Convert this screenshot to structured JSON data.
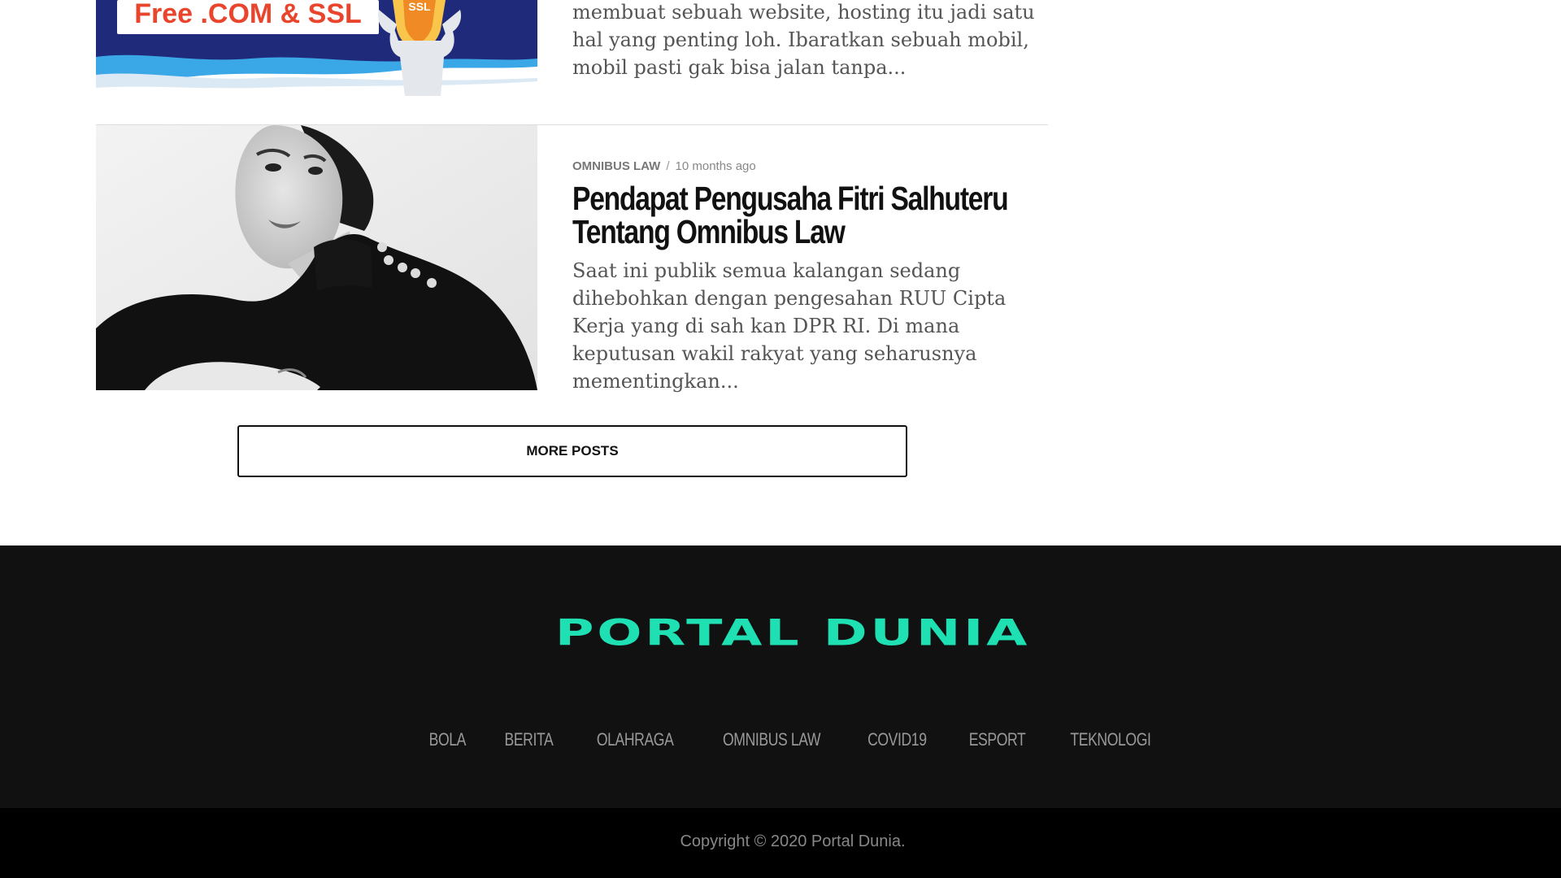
{
  "posts": [
    {
      "image_text": "Free .COM & SSL",
      "badge_text": "SSL",
      "excerpt": "membuat sebuah website, hosting itu jadi satu hal yang penting loh. Ibaratkan sebuah mobil, mobil pasti gak bisa jalan tanpa..."
    },
    {
      "category": "OMNIBUS LAW",
      "separator": "/",
      "time": "10 months ago",
      "title": "Pendapat Pengusaha Fitri Salhuteru Tentang Omnibus Law",
      "excerpt": "Saat ini publik semua kalangan sedang dihebohkan dengan pengesahan RUU Cipta Kerja yang di sah kan DPR RI. Di mana keputusan wakil rakyat yang seharusnya mementingkan..."
    }
  ],
  "more_posts_label": "MORE POSTS",
  "footer": {
    "logo": "PORTAL DUNIA",
    "logo_color": "#1ee0b2",
    "nav": [
      "BOLA",
      "BERITA",
      "OLAHRAGA",
      "OMNIBUS LAW",
      "COVID19",
      "ESPORT",
      "TEKNOLOGI"
    ],
    "copyright": "Copyright © 2020 Portal Dunia."
  }
}
